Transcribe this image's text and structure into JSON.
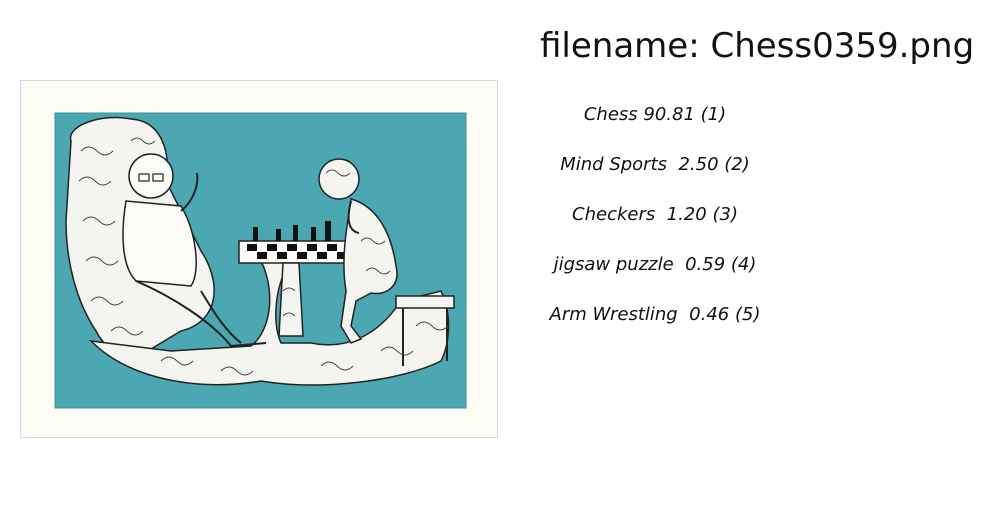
{
  "title": "filename: Chess0359.png",
  "image": {
    "subject": "two brain-textured figures playing chess on a teal background",
    "background_color": "#4ba8b3",
    "mat_color": "#fdfdf6"
  },
  "predictions": [
    {
      "text": "Chess 90.81 (1)"
    },
    {
      "text": "Mind Sports  2.50 (2)"
    },
    {
      "text": "Checkers  1.20 (3)"
    },
    {
      "text": "jigsaw puzzle  0.59 (4)"
    },
    {
      "text": "Arm Wrestling  0.46 (5)"
    }
  ]
}
